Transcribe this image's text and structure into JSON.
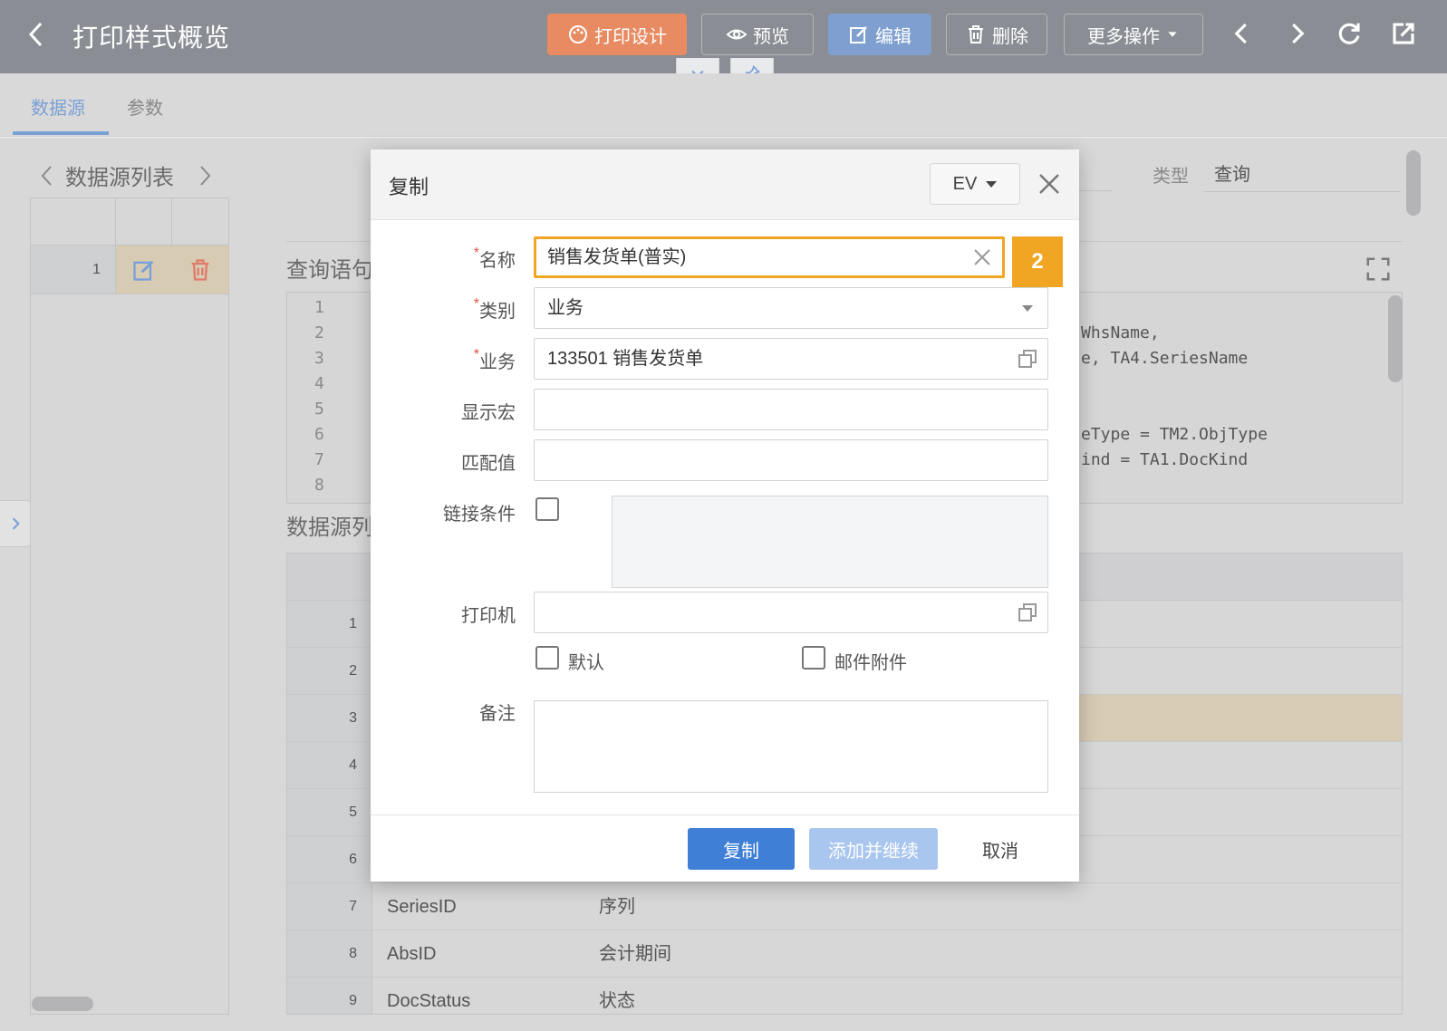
{
  "topbar": {
    "title": "打印样式概览",
    "buttons": {
      "design": "打印设计",
      "preview": "预览",
      "edit": "编辑",
      "delete": "删除",
      "more": "更多操作"
    }
  },
  "tabs": [
    "数据源",
    "参数"
  ],
  "left_panel": {
    "title": "数据源列表",
    "rows": [
      {
        "num": "1"
      }
    ]
  },
  "background": {
    "section_query": "查询语句",
    "section_datasource_list": "数据源列表",
    "type_label": "类型",
    "type_value": "查询",
    "code_line_numbers": [
      "1",
      "2",
      "3",
      "4",
      "5",
      "6",
      "7",
      "8"
    ],
    "code_snippets": [
      {
        "line": 2,
        "text": "WhsName,"
      },
      {
        "line": 3,
        "text": "e, TA4.SeriesName"
      },
      {
        "line": 6,
        "text": "eType = TM2.ObjType"
      },
      {
        "line": 7,
        "text": "ind = TA1.DocKind"
      }
    ],
    "grid_rows": [
      {
        "num": "1",
        "c1": "",
        "c2": ""
      },
      {
        "num": "2",
        "c1": "",
        "c2": ""
      },
      {
        "num": "3",
        "c1": "",
        "c2": ""
      },
      {
        "num": "4",
        "c1": "",
        "c2": ""
      },
      {
        "num": "5",
        "c1": "",
        "c2": ""
      },
      {
        "num": "6",
        "c1": "",
        "c2": ""
      },
      {
        "num": "7",
        "c1": "SeriesID",
        "c2": "序列"
      },
      {
        "num": "8",
        "c1": "AbsID",
        "c2": "会计期间"
      },
      {
        "num": "9",
        "c1": "DocStatus",
        "c2": "状态"
      }
    ]
  },
  "modal": {
    "title": "复制",
    "language": "EV",
    "badge": "2",
    "fields": {
      "name": {
        "label": "名称",
        "required": true,
        "value": "销售发货单(普实)"
      },
      "category": {
        "label": "类别",
        "required": true,
        "value": "业务"
      },
      "business": {
        "label": "业务",
        "required": true,
        "value": "133501 销售发货单"
      },
      "display_macro": {
        "label": "显示宏",
        "value": ""
      },
      "match_value": {
        "label": "匹配值",
        "value": ""
      },
      "link_condition": {
        "label": "链接条件",
        "checked": false
      },
      "printer": {
        "label": "打印机",
        "value": ""
      },
      "default": {
        "label": "默认",
        "checked": false
      },
      "mail_attachment": {
        "label": "邮件附件",
        "checked": false
      },
      "remark": {
        "label": "备注",
        "value": ""
      }
    },
    "buttons": {
      "copy": "复制",
      "add_continue": "添加并继续",
      "cancel": "取消"
    }
  },
  "colors": {
    "design_button": "#e88b62",
    "edit_button": "#7e9fd0",
    "primary": "#3f7fd6",
    "focus_highlight": "#f0a523",
    "required": "#e0533f"
  }
}
